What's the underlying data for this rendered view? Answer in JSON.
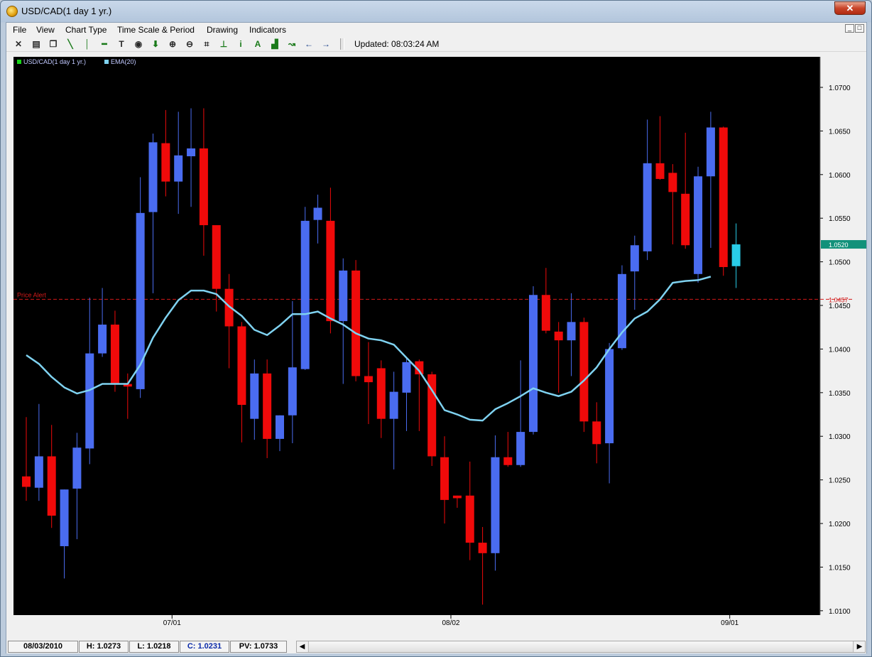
{
  "window": {
    "title": "USD/CAD(1 day  1 yr.)",
    "close_label": "✕"
  },
  "menu": [
    {
      "label": "File"
    },
    {
      "label": "View"
    },
    {
      "label": "Chart Type"
    },
    {
      "label": "Time Scale & Period"
    },
    {
      "label": "Drawing"
    },
    {
      "label": "Indicators"
    }
  ],
  "mdi_controls": {
    "minimize": "_",
    "restore": "□"
  },
  "toolbar": {
    "tools": [
      {
        "name": "crosshair-icon",
        "glyph": "✕"
      },
      {
        "name": "print-icon",
        "glyph": "▤"
      },
      {
        "name": "copy-icon",
        "glyph": "❐"
      },
      {
        "name": "line-draw-icon",
        "glyph": "╲"
      },
      {
        "name": "vertical-line-icon",
        "glyph": "│"
      },
      {
        "name": "horizontal-line-icon",
        "glyph": "━"
      },
      {
        "name": "text-tool-icon",
        "glyph": "T"
      },
      {
        "name": "target-icon",
        "glyph": "◉"
      },
      {
        "name": "arrow-down-icon",
        "glyph": "⬇"
      },
      {
        "name": "zoom-in-icon",
        "glyph": "⊕"
      },
      {
        "name": "zoom-out-icon",
        "glyph": "⊖"
      },
      {
        "name": "fit-icon",
        "glyph": "⌗"
      },
      {
        "name": "baseline-icon",
        "glyph": "⊥"
      },
      {
        "name": "info-icon",
        "glyph": "i"
      },
      {
        "name": "annotation-a-icon",
        "glyph": "A"
      },
      {
        "name": "bar-chart-icon",
        "glyph": "▟"
      },
      {
        "name": "line-chart-icon",
        "glyph": "↝"
      },
      {
        "name": "scroll-left-icon",
        "glyph": "←"
      },
      {
        "name": "scroll-right-icon",
        "glyph": "→"
      }
    ],
    "updated": "Updated: 08:03:24 AM"
  },
  "legend": {
    "price": {
      "label": "USD/CAD(1 day  1 yr.)",
      "color": "#19d419"
    },
    "ema": {
      "label": "EMA(20)",
      "color": "#7fd2f0"
    }
  },
  "price_alert": {
    "label": "Price Alert",
    "value_label": "1.0457",
    "color": "#d21a1a"
  },
  "last_price": {
    "label": "1.0520",
    "color": "#12917a"
  },
  "colors": {
    "up": "#4a6cf0",
    "down": "#f00a0a",
    "current": "#29cde8",
    "ema": "#7fd2f0",
    "bg": "#000000",
    "axis_text": "#000000"
  },
  "status": {
    "date": "08/03/2010",
    "high": "H: 1.0273",
    "low": "L: 1.0218",
    "close": "C: 1.0231",
    "pv": "PV: 1.0733",
    "left_arrow": "◀",
    "right_arrow": "▶"
  },
  "chart_data": {
    "type": "candlestick",
    "title": "",
    "ylim": [
      1.0095,
      1.0735
    ],
    "yticks": [
      "1.0700",
      "1.0650",
      "1.0600",
      "1.0550",
      "1.0500",
      "1.0450",
      "1.0400",
      "1.0350",
      "1.0300",
      "1.0250",
      "1.0200",
      "1.0150",
      "1.0100"
    ],
    "ytick_values": [
      1.07,
      1.065,
      1.06,
      1.055,
      1.05,
      1.045,
      1.04,
      1.035,
      1.03,
      1.025,
      1.02,
      1.015,
      1.01
    ],
    "xticks": [
      {
        "label": "07/01",
        "index": 11.5
      },
      {
        "label": "08/02",
        "index": 33.5
      },
      {
        "label": "09/01",
        "index": 55.5
      }
    ],
    "candles": [
      {
        "o": 1.0254,
        "h": 1.0322,
        "l": 1.0226,
        "c": 1.0242
      },
      {
        "o": 1.0241,
        "h": 1.0337,
        "l": 1.0226,
        "c": 1.0277
      },
      {
        "o": 1.0277,
        "h": 1.0313,
        "l": 1.0195,
        "c": 1.0209
      },
      {
        "o": 1.0174,
        "h": 1.0238,
        "l": 1.0137,
        "c": 1.0239
      },
      {
        "o": 1.024,
        "h": 1.0304,
        "l": 1.0182,
        "c": 1.0287
      },
      {
        "o": 1.0286,
        "h": 1.0459,
        "l": 1.0268,
        "c": 1.0395
      },
      {
        "o": 1.0395,
        "h": 1.047,
        "l": 1.0391,
        "c": 1.0428
      },
      {
        "o": 1.0428,
        "h": 1.0444,
        "l": 1.0351,
        "c": 1.036
      },
      {
        "o": 1.036,
        "h": 1.0372,
        "l": 1.032,
        "c": 1.0357
      },
      {
        "o": 1.0354,
        "h": 1.0597,
        "l": 1.0344,
        "c": 1.0556
      },
      {
        "o": 1.0557,
        "h": 1.0647,
        "l": 1.0464,
        "c": 1.0637
      },
      {
        "o": 1.0636,
        "h": 1.0674,
        "l": 1.0575,
        "c": 1.0592
      },
      {
        "o": 1.0592,
        "h": 1.0672,
        "l": 1.0555,
        "c": 1.0622
      },
      {
        "o": 1.0621,
        "h": 1.0676,
        "l": 1.0563,
        "c": 1.063
      },
      {
        "o": 1.063,
        "h": 1.0676,
        "l": 1.0507,
        "c": 1.0542
      },
      {
        "o": 1.0542,
        "h": 1.0511,
        "l": 1.0443,
        "c": 1.0469
      },
      {
        "o": 1.0469,
        "h": 1.0486,
        "l": 1.0378,
        "c": 1.0426
      },
      {
        "o": 1.0426,
        "h": 1.0431,
        "l": 1.0293,
        "c": 1.0336
      },
      {
        "o": 1.032,
        "h": 1.0388,
        "l": 1.0296,
        "c": 1.0372
      },
      {
        "o": 1.0372,
        "h": 1.0388,
        "l": 1.0275,
        "c": 1.0297
      },
      {
        "o": 1.0297,
        "h": 1.0323,
        "l": 1.0283,
        "c": 1.0324
      },
      {
        "o": 1.0324,
        "h": 1.0455,
        "l": 1.0292,
        "c": 1.0379
      },
      {
        "o": 1.0377,
        "h": 1.0563,
        "l": 1.0376,
        "c": 1.0547
      },
      {
        "o": 1.0548,
        "h": 1.0577,
        "l": 1.0521,
        "c": 1.0562
      },
      {
        "o": 1.0547,
        "h": 1.0585,
        "l": 1.0418,
        "c": 1.0432
      },
      {
        "o": 1.0432,
        "h": 1.0504,
        "l": 1.036,
        "c": 1.049
      },
      {
        "o": 1.049,
        "h": 1.0502,
        "l": 1.0363,
        "c": 1.0369
      },
      {
        "o": 1.0369,
        "h": 1.0408,
        "l": 1.0314,
        "c": 1.0362
      },
      {
        "o": 1.0378,
        "h": 1.0387,
        "l": 1.0298,
        "c": 1.032
      },
      {
        "o": 1.032,
        "h": 1.0374,
        "l": 1.0262,
        "c": 1.0351
      },
      {
        "o": 1.035,
        "h": 1.039,
        "l": 1.0306,
        "c": 1.0385
      },
      {
        "o": 1.0386,
        "h": 1.0388,
        "l": 1.0306,
        "c": 1.0371
      },
      {
        "o": 1.0371,
        "h": 1.0374,
        "l": 1.0266,
        "c": 1.0277
      },
      {
        "o": 1.0276,
        "h": 1.03,
        "l": 1.02,
        "c": 1.0227
      },
      {
        "o": 1.0232,
        "h": 1.0232,
        "l": 1.0218,
        "c": 1.0229
      },
      {
        "o": 1.0232,
        "h": 1.0271,
        "l": 1.0158,
        "c": 1.0178
      },
      {
        "o": 1.0178,
        "h": 1.0196,
        "l": 1.0107,
        "c": 1.0166
      },
      {
        "o": 1.0166,
        "h": 1.0301,
        "l": 1.0146,
        "c": 1.0276
      },
      {
        "o": 1.0276,
        "h": 1.0305,
        "l": 1.0265,
        "c": 1.0267
      },
      {
        "o": 1.0267,
        "h": 1.0387,
        "l": 1.0265,
        "c": 1.0305
      },
      {
        "o": 1.0305,
        "h": 1.0472,
        "l": 1.0302,
        "c": 1.0462
      },
      {
        "o": 1.0462,
        "h": 1.0493,
        "l": 1.0418,
        "c": 1.0421
      },
      {
        "o": 1.042,
        "h": 1.0431,
        "l": 1.035,
        "c": 1.041
      },
      {
        "o": 1.041,
        "h": 1.0464,
        "l": 1.0369,
        "c": 1.0431
      },
      {
        "o": 1.0431,
        "h": 1.0436,
        "l": 1.0305,
        "c": 1.0317
      },
      {
        "o": 1.0317,
        "h": 1.0339,
        "l": 1.0269,
        "c": 1.0291
      },
      {
        "o": 1.0292,
        "h": 1.0407,
        "l": 1.0246,
        "c": 1.04
      },
      {
        "o": 1.0401,
        "h": 1.0496,
        "l": 1.0399,
        "c": 1.0486
      },
      {
        "o": 1.0489,
        "h": 1.053,
        "l": 1.0445,
        "c": 1.0519
      },
      {
        "o": 1.0512,
        "h": 1.0663,
        "l": 1.0502,
        "c": 1.0613
      },
      {
        "o": 1.0613,
        "h": 1.0667,
        "l": 1.0594,
        "c": 1.0595
      },
      {
        "o": 1.0602,
        "h": 1.0612,
        "l": 1.052,
        "c": 1.058
      },
      {
        "o": 1.0578,
        "h": 1.0648,
        "l": 1.0515,
        "c": 1.0519
      },
      {
        "o": 1.0486,
        "h": 1.0609,
        "l": 1.0476,
        "c": 1.0598
      },
      {
        "o": 1.0598,
        "h": 1.0672,
        "l": 1.0516,
        "c": 1.0654
      },
      {
        "o": 1.0654,
        "h": 1.0655,
        "l": 1.0484,
        "c": 1.0494
      },
      {
        "o": 1.0495,
        "h": 1.0544,
        "l": 1.047,
        "c": 1.052
      }
    ],
    "ema": [
      1.0393,
      1.0383,
      1.0368,
      1.0356,
      1.0349,
      1.0353,
      1.036,
      1.036,
      1.036,
      1.0382,
      1.0413,
      1.0436,
      1.0456,
      1.0467,
      1.0467,
      1.0463,
      1.0449,
      1.0438,
      1.0422,
      1.0416,
      1.0427,
      1.044,
      1.044,
      1.0443,
      1.0435,
      1.0428,
      1.0418,
      1.0412,
      1.041,
      1.0405,
      1.039,
      1.0375,
      1.0353,
      1.033,
      1.0325,
      1.0319,
      1.0318,
      1.0331,
      1.0338,
      1.0346,
      1.0355,
      1.035,
      1.0346,
      1.0351,
      1.0364,
      1.0379,
      1.04,
      1.0419,
      1.0435,
      1.0443,
      1.0457,
      1.0476,
      1.0478,
      1.0479,
      1.0483
    ],
    "ema_start_index": 0,
    "price_alert_level": 1.0457,
    "last_price": 1.052
  }
}
